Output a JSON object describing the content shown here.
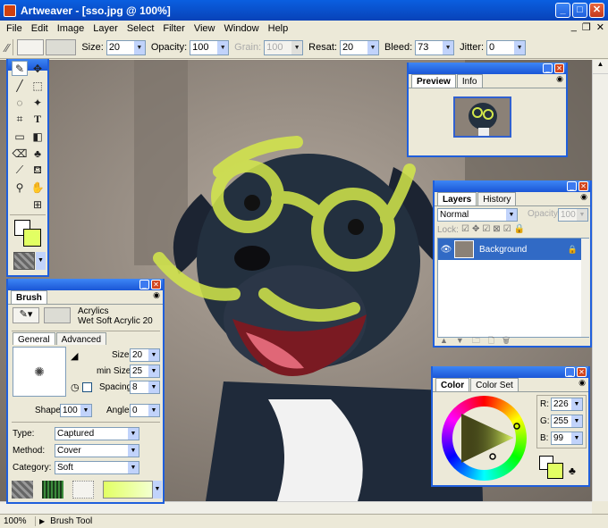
{
  "window": {
    "title": "Artweaver - [sso.jpg @ 100%]"
  },
  "menu": [
    "File",
    "Edit",
    "Image",
    "Layer",
    "Select",
    "Filter",
    "View",
    "Window",
    "Help"
  ],
  "options": {
    "size_label": "Size:",
    "size_value": "20",
    "opacity_label": "Opacity:",
    "opacity_value": "100",
    "grain_label": "Grain:",
    "grain_value": "100",
    "resat_label": "Resat:",
    "resat_value": "20",
    "bleed_label": "Bleed:",
    "bleed_value": "73",
    "jitter_label": "Jitter:",
    "jitter_value": "0"
  },
  "preview": {
    "tabs": [
      "Preview",
      "Info"
    ]
  },
  "layers": {
    "tabs": [
      "Layers",
      "History"
    ],
    "blend_mode": "Normal",
    "opacity_label": "Opacity:",
    "opacity_value": "100",
    "lock_label": "Lock:",
    "layer_name": "Background"
  },
  "brush": {
    "title": "Brush",
    "category": "Acrylics",
    "variant": "Wet Soft Acrylic 20",
    "tabs": [
      "General",
      "Advanced"
    ],
    "size_label": "Size:",
    "size_value": "20",
    "min_size_label": "min Size:",
    "min_size_value": "25",
    "spacing_label": "Spacing:",
    "spacing_value": "8",
    "shape_label": "Shape:",
    "shape_value": "100",
    "angle_label": "Angle:",
    "angle_value": "0",
    "type_label": "Type:",
    "type_value": "Captured",
    "method_label": "Method:",
    "method_value": "Cover",
    "cat_label": "Category:",
    "cat_value": "Soft"
  },
  "color": {
    "tabs": [
      "Color",
      "Color Set"
    ],
    "r_label": "R:",
    "r_value": "226",
    "g_label": "G:",
    "g_value": "255",
    "b_label": "B:",
    "b_value": "99",
    "foreground": "#e2ff63"
  },
  "status": {
    "zoom": "100%",
    "tool": "Brush Tool"
  },
  "colors": {
    "title_blue": "#0a5fe0",
    "stroke": "#d4e84a"
  }
}
